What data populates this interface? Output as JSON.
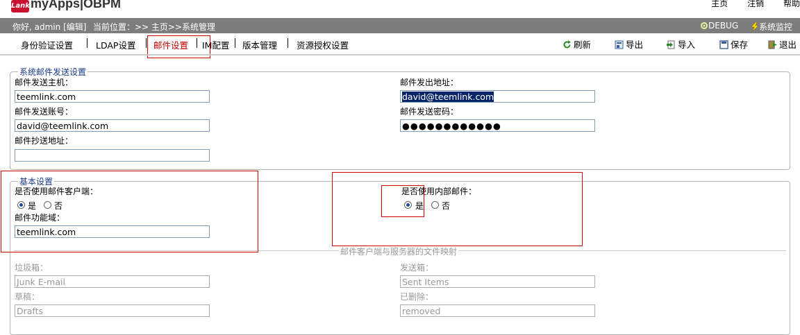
{
  "app": {
    "logo_mark": "Lank",
    "title": "myApps|OBPM"
  },
  "top_links": [
    "主页",
    "注销",
    "帮助"
  ],
  "userbar": {
    "greeting": "你好, admin [编辑]",
    "location": "当前位置：>> 主页>>系统管理",
    "debug": "DEBUG",
    "monitor": "系统监控"
  },
  "tabs": [
    "身份验证设置",
    "LDAP设置",
    "邮件设置",
    "IM配置",
    "版本管理",
    "资源授权设置"
  ],
  "actions": [
    "刷新",
    "导出",
    "导入",
    "保存",
    "退出"
  ],
  "mail_send": {
    "legend": "系统邮件发送设置",
    "host_label": "邮件发送主机：",
    "host_value": "teemlink.com",
    "from_label": "邮件发出地址：",
    "from_value": "david@teemlink.com",
    "account_label": "邮件发送账号：",
    "account_value": "david@teemlink.com",
    "password_label": "邮件发送密码：",
    "password_value": "●●●●●●●●●●●●",
    "cc_label": "邮件抄送地址：",
    "cc_value": ""
  },
  "basic": {
    "legend": "基本设置",
    "client_label": "是否使用邮件客户端：",
    "internal_label": "是否使用内部邮件：",
    "yes": "是",
    "no": "否",
    "domain_label": "邮件功能域：",
    "domain_value": "teemlink.com",
    "mapping_title": "邮件客户端与服务器的文件映射",
    "trash_label": "垃圾箱：",
    "trash_value": "Junk E-mail",
    "sent_label": "发送箱：",
    "sent_value": "Sent Items",
    "drafts_label": "草稿：",
    "drafts_value": "Drafts",
    "deleted_label": "已删除：",
    "deleted_value": "removed"
  },
  "colors": {
    "accent_red": "#d40000",
    "userbar_bg": "#7d7d7d",
    "legend_blue": "#1a3c8c"
  }
}
